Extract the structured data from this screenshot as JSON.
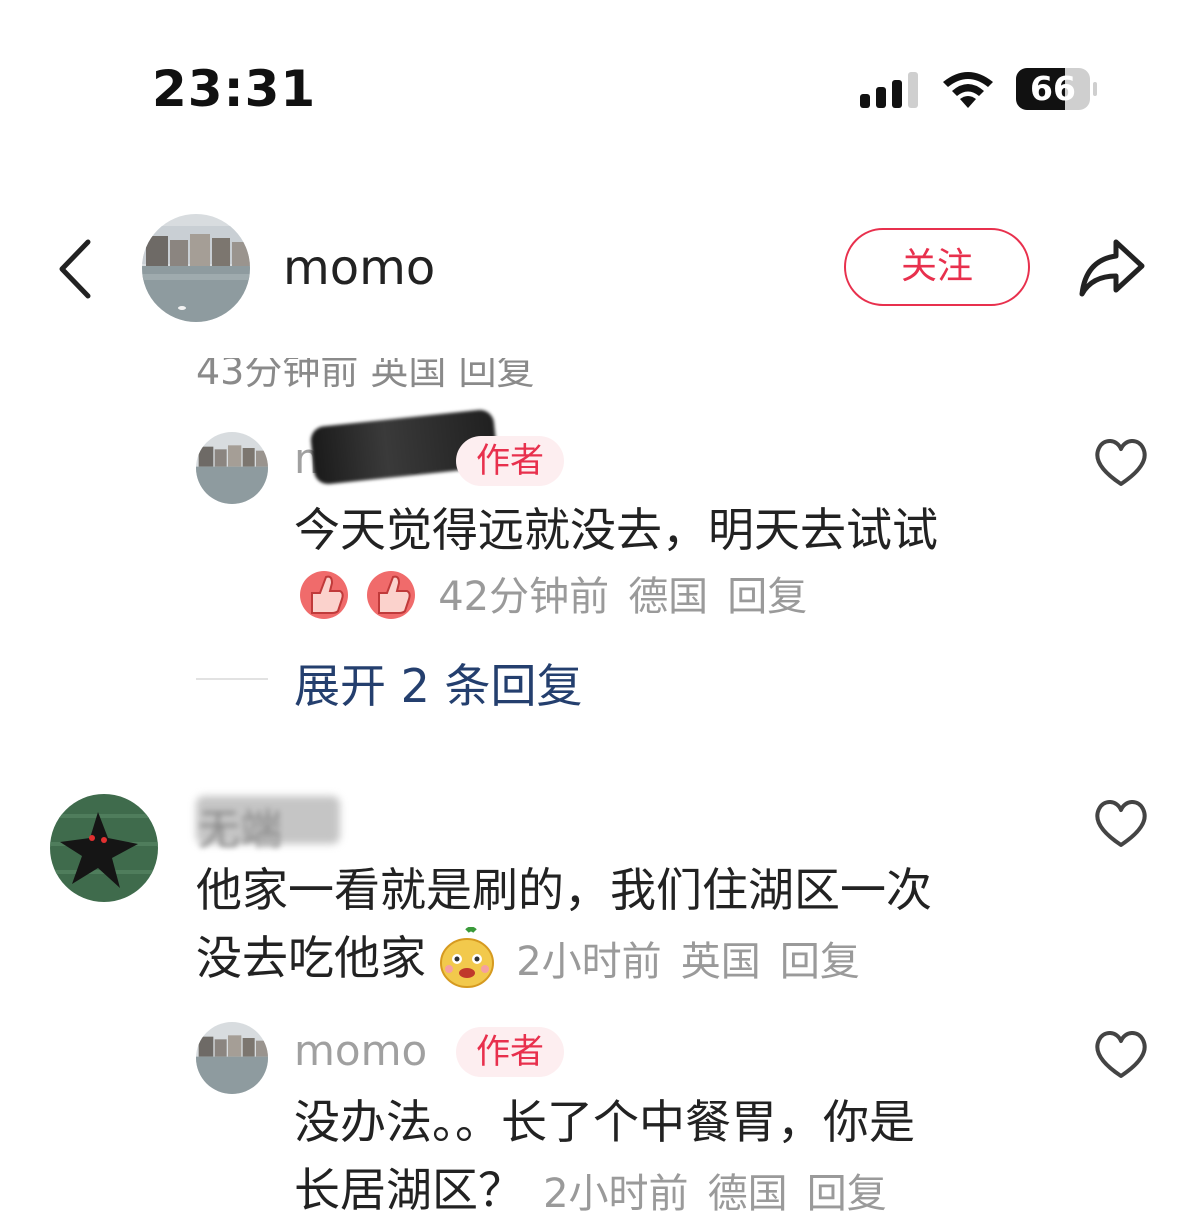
{
  "status_bar": {
    "time": "23:31",
    "battery": "66",
    "battery_level": 0.66
  },
  "header": {
    "username": "momo",
    "follow_label": "关注"
  },
  "comments": {
    "previous_meta": "43分钟前  英国  回复",
    "reply1": {
      "username": "momo",
      "badge": "作者",
      "text": "今天觉得远就没去，明天去试试",
      "time": "42分钟前",
      "location": "德国",
      "reply_label": "回复",
      "emoji": "thumbs-up-icon"
    },
    "expand_label": "展开 2 条回复",
    "comment2": {
      "username": "无端",
      "text_line1": "他家一看就是刷的，我们住湖区一次",
      "text_line2": "没去吃他家",
      "time": "2小时前",
      "location": "英国",
      "reply_label": "回复",
      "emoji": "cartoon-face-icon"
    },
    "reply2": {
      "username": "momo",
      "badge": "作者",
      "text_line1": "没办法。。长了个中餐胃，你是",
      "text_line2": "长居湖区？",
      "time": "2小时前",
      "location": "德国",
      "reply_label": "回复"
    }
  },
  "colors": {
    "accent": "#e8304d",
    "link": "#243f6e",
    "meta": "#9a9a9a"
  }
}
